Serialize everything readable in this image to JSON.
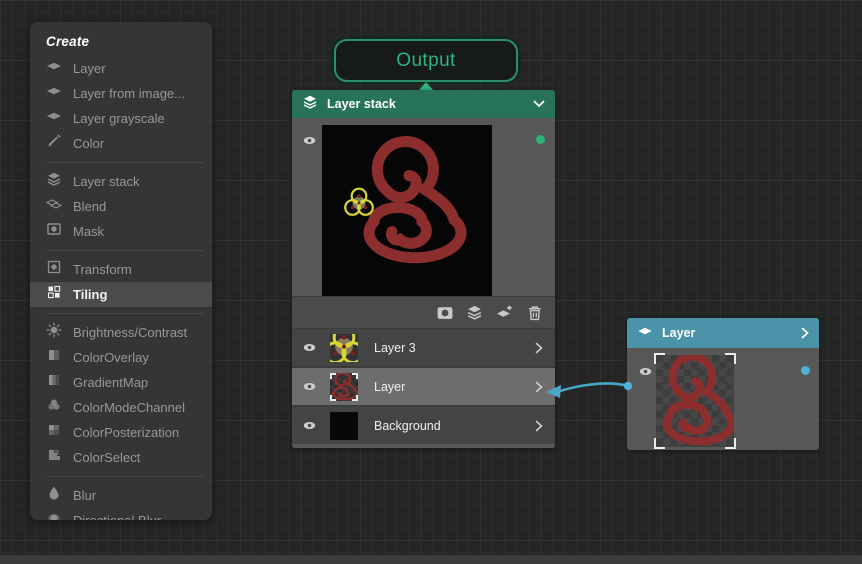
{
  "colors": {
    "accent_green": "#2fb27e",
    "stack_header_green": "#26735a",
    "layer_header_cyan": "#4b93a9",
    "connection_cyan": "#48a8c8",
    "swirl_red": "#8c2e2e",
    "trefoil_yellow": "#d8d835"
  },
  "menu": {
    "title": "Create",
    "items": [
      {
        "label": "Layer",
        "icon": "layer-icon",
        "selected": false,
        "divider_after": false
      },
      {
        "label": "Layer from image...",
        "icon": "layer-icon",
        "selected": false,
        "divider_after": false
      },
      {
        "label": "Layer grayscale",
        "icon": "layer-icon",
        "selected": false,
        "divider_after": false
      },
      {
        "label": "Color",
        "icon": "color-icon",
        "selected": false,
        "divider_after": true
      },
      {
        "label": "Layer stack",
        "icon": "layer-stack-icon",
        "selected": false,
        "divider_after": false
      },
      {
        "label": "Blend",
        "icon": "blend-icon",
        "selected": false,
        "divider_after": false
      },
      {
        "label": "Mask",
        "icon": "mask-icon",
        "selected": false,
        "divider_after": true
      },
      {
        "label": "Transform",
        "icon": "transform-icon",
        "selected": false,
        "divider_after": false
      },
      {
        "label": "Tiling",
        "icon": "tiling-icon",
        "selected": true,
        "divider_after": true
      },
      {
        "label": "Brightness/Contrast",
        "icon": "brightness-contrast-icon",
        "selected": false,
        "divider_after": false
      },
      {
        "label": "ColorOverlay",
        "icon": "color-overlay-icon",
        "selected": false,
        "divider_after": false
      },
      {
        "label": "GradientMap",
        "icon": "gradient-map-icon",
        "selected": false,
        "divider_after": false
      },
      {
        "label": "ColorModeChannel",
        "icon": "color-mode-channel-icon",
        "selected": false,
        "divider_after": false
      },
      {
        "label": "ColorPosterization",
        "icon": "color-posterization-icon",
        "selected": false,
        "divider_after": false
      },
      {
        "label": "ColorSelect",
        "icon": "color-select-icon",
        "selected": false,
        "divider_after": true
      },
      {
        "label": "Blur",
        "icon": "blur-icon",
        "selected": false,
        "divider_after": false
      },
      {
        "label": "Directional Blur",
        "icon": "directional-blur-icon",
        "selected": false,
        "divider_after": false
      }
    ]
  },
  "output_node": {
    "label": "Output"
  },
  "stack_node": {
    "title": "Layer stack",
    "collapse_icon": "chevron-down-icon",
    "preview_visible": true,
    "toolbar": [
      {
        "name": "mask",
        "icon": "mask-tool-icon"
      },
      {
        "name": "layer-stack",
        "icon": "layers-tool-icon"
      },
      {
        "name": "add-layer",
        "icon": "add-layer-tool-icon"
      },
      {
        "name": "delete",
        "icon": "trash-icon"
      }
    ],
    "rows": [
      {
        "label": "Layer 3",
        "thumb": "trefoil",
        "visible": true,
        "selected": false
      },
      {
        "label": "Layer",
        "thumb": "swirl",
        "visible": true,
        "selected": true
      },
      {
        "label": "Background",
        "thumb": "black",
        "visible": true,
        "selected": false
      }
    ]
  },
  "layer_node": {
    "title": "Layer",
    "visible": true
  }
}
